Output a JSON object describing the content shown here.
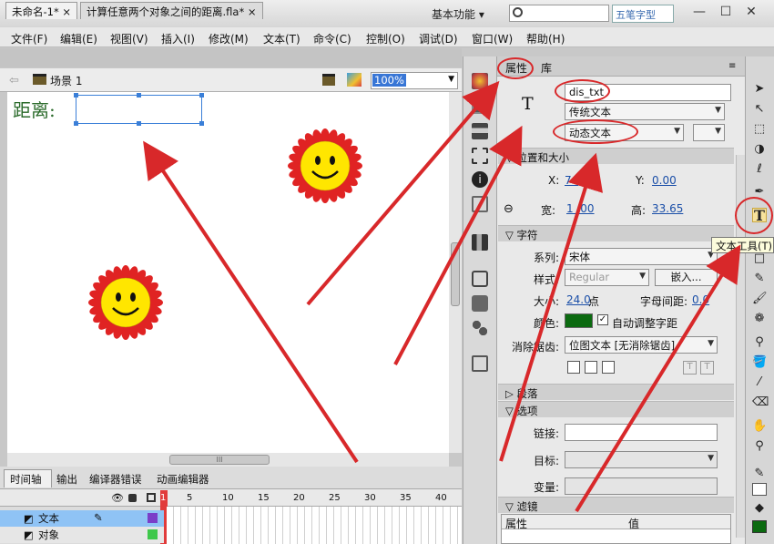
{
  "app": {
    "logo": "Fl",
    "workspace": "基本功能",
    "watermark": "五笔字型",
    "controls": [
      "—",
      "☐",
      "✕"
    ]
  },
  "menu": [
    "文件(F)",
    "编辑(E)",
    "视图(V)",
    "插入(I)",
    "修改(M)",
    "文本(T)",
    "命令(C)",
    "控制(O)",
    "调试(D)",
    "窗口(W)",
    "帮助(H)"
  ],
  "document": {
    "tabs": [
      {
        "label": "未命名-1*",
        "close": "×"
      },
      {
        "label": "计算任意两个对象之间的距离.fla*",
        "close": "×"
      }
    ],
    "scene": "场景 1",
    "zoom": "100%",
    "stage_text": "距离:",
    "hscroll_grip": "III"
  },
  "timeline": {
    "tabs": [
      "时间轴",
      "输出",
      "编译器错误",
      "动画编辑器"
    ],
    "frame_numbers": [
      "1",
      "5",
      "10",
      "15",
      "20",
      "25",
      "30",
      "35",
      "40"
    ],
    "layers": [
      {
        "name": "文本",
        "selected": true
      },
      {
        "name": "对象",
        "selected": false
      }
    ],
    "layer_colors": [
      "#7a3fc8",
      "#3fc84b"
    ]
  },
  "properties": {
    "tabs": [
      "属性",
      "库"
    ],
    "instance_name": "dis_txt",
    "text_engine": "传统文本",
    "text_type": "动态文本",
    "tool_glyph": "T",
    "sections": {
      "position": "位置和大小",
      "character": "字符",
      "paragraph": "段落",
      "options": "选项",
      "filters": "滤镜"
    },
    "x_label": "X:",
    "x_value": "74",
    "y_label": "Y:",
    "y_value": "0.00",
    "w_label": "宽:",
    "w_value": "1 .00",
    "h_label": "高:",
    "h_value": "33.65",
    "family_label": "系列:",
    "family": "宋体",
    "style_label": "样式:",
    "style": "Regular",
    "embed": "嵌入...",
    "size_label": "大小:",
    "size": "24.0",
    "size_unit": "点",
    "spacing_label": "字母间距:",
    "spacing": "0.0",
    "color_label": "颜色:",
    "color_swatch": "#0b6a10",
    "auto_kern": "自动调整字距",
    "aa_label": "消除锯齿:",
    "aa": "位图文本 [无消除锯齿]",
    "link_label": "链接:",
    "target_label": "目标:",
    "var_label": "变量:",
    "filter_cols": [
      "属性",
      "值"
    ]
  },
  "tooltip": "文本工具(T)",
  "colors": {
    "annotation_red": "#d8282a",
    "sun_petals": "#e02323",
    "sun_face": "#ffe600",
    "stage_text": "#2b6b2b"
  }
}
